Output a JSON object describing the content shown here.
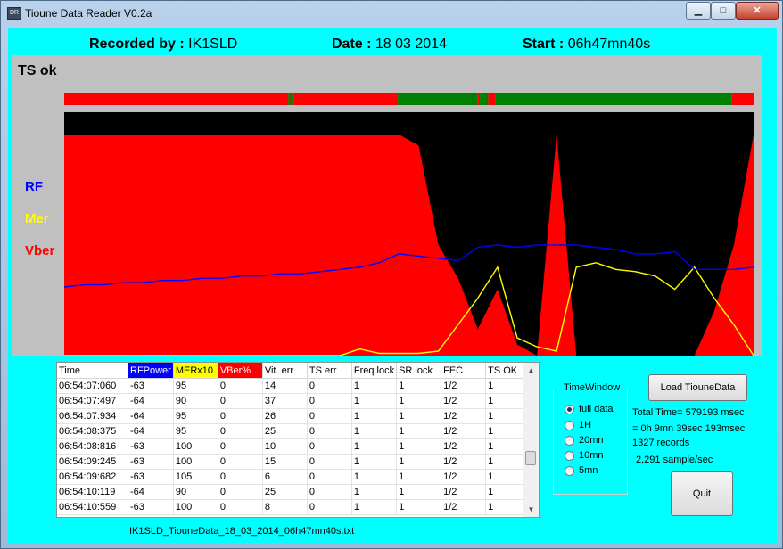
{
  "window": {
    "title": "Tioune Data Reader V0.2a",
    "icon_text": "DR",
    "min_glyph": "▁",
    "max_glyph": "□",
    "close_glyph": "✕"
  },
  "header": {
    "recorded_label": "Recorded by :",
    "recorded_value": "IK1SLD",
    "date_label": "Date :",
    "date_value": "18 03 2014",
    "start_label": "Start :",
    "start_value": "06h47mn40s"
  },
  "chart": {
    "ts_label": "TS ok",
    "rf_label": "RF",
    "mer_label": "Mer",
    "vber_label": "Vber",
    "colors": {
      "rf": "#0000ff",
      "mer": "#ffff00",
      "vber": "#ff0000",
      "ts_ok": "#008000",
      "ts_bad": "#ff0000",
      "background": "#000000",
      "panel": "#c0c0c0"
    }
  },
  "chart_data": {
    "type": "area",
    "title": "",
    "xlabel": "",
    "ylabel": "",
    "series": [
      {
        "name": "RF",
        "color": "#0000ff",
        "values": [
          31,
          32,
          32,
          33,
          33,
          34,
          34,
          35,
          35,
          36,
          36,
          37,
          37,
          38,
          39,
          40,
          42,
          46,
          45,
          44,
          43,
          49,
          50,
          49,
          50,
          50,
          50,
          49,
          48,
          46,
          46,
          47,
          39,
          39,
          39,
          40
        ]
      },
      {
        "name": "Mer",
        "color": "#ffff00",
        "values": [
          0,
          0,
          0,
          0,
          0,
          0,
          0,
          0,
          0,
          0,
          0,
          0,
          0,
          0,
          0,
          3,
          1,
          1,
          1,
          2,
          14,
          26,
          40,
          8,
          4,
          2,
          40,
          42,
          39,
          38,
          36,
          30,
          40,
          26,
          14,
          0
        ]
      },
      {
        "name": "Vber",
        "color": "#ff0000",
        "values": [
          100,
          100,
          100,
          100,
          100,
          100,
          100,
          100,
          100,
          100,
          100,
          100,
          100,
          100,
          100,
          100,
          100,
          100,
          95,
          50,
          35,
          12,
          30,
          5,
          0,
          100,
          0,
          0,
          0,
          0,
          0,
          0,
          0,
          20,
          50,
          100
        ]
      }
    ],
    "ts_ok": {
      "segments": [
        {
          "state": "bad",
          "from": 0,
          "to": 0.325
        },
        {
          "state": "ok",
          "from": 0.325,
          "to": 0.328
        },
        {
          "state": "bad",
          "from": 0.328,
          "to": 0.33
        },
        {
          "state": "ok",
          "from": 0.33,
          "to": 0.333
        },
        {
          "state": "bad",
          "from": 0.333,
          "to": 0.484
        },
        {
          "state": "ok",
          "from": 0.484,
          "to": 0.6
        },
        {
          "state": "bad",
          "from": 0.6,
          "to": 0.603
        },
        {
          "state": "ok",
          "from": 0.603,
          "to": 0.615
        },
        {
          "state": "bad",
          "from": 0.615,
          "to": 0.625
        },
        {
          "state": "ok",
          "from": 0.625,
          "to": 0.968
        },
        {
          "state": "bad",
          "from": 0.968,
          "to": 1
        }
      ]
    },
    "ylim": [
      0,
      100
    ],
    "grid": false,
    "legend": "left"
  },
  "table": {
    "columns": [
      {
        "label": "Time",
        "bg": ""
      },
      {
        "label": "RFPower",
        "bg": "#0000ff",
        "fg": "#ffffff"
      },
      {
        "label": "MERx10",
        "bg": "#ffff00",
        "fg": "#000000"
      },
      {
        "label": "VBer%",
        "bg": "#ff0000",
        "fg": "#ffffff"
      },
      {
        "label": "Vit. err",
        "bg": ""
      },
      {
        "label": "TS err",
        "bg": ""
      },
      {
        "label": "Freq lock",
        "bg": ""
      },
      {
        "label": "SR lock",
        "bg": ""
      },
      {
        "label": "FEC",
        "bg": ""
      },
      {
        "label": "TS OK",
        "bg": ""
      }
    ],
    "rows": [
      [
        "06:54:07:060",
        "-63",
        "95",
        "0",
        "14",
        "0",
        "1",
        "1",
        "1/2",
        "1"
      ],
      [
        "06:54:07:497",
        "-64",
        "90",
        "0",
        "37",
        "0",
        "1",
        "1",
        "1/2",
        "1"
      ],
      [
        "06:54:07:934",
        "-64",
        "95",
        "0",
        "26",
        "0",
        "1",
        "1",
        "1/2",
        "1"
      ],
      [
        "06:54:08:375",
        "-64",
        "95",
        "0",
        "25",
        "0",
        "1",
        "1",
        "1/2",
        "1"
      ],
      [
        "06:54:08:816",
        "-63",
        "100",
        "0",
        "10",
        "0",
        "1",
        "1",
        "1/2",
        "1"
      ],
      [
        "06:54:09:245",
        "-63",
        "100",
        "0",
        "15",
        "0",
        "1",
        "1",
        "1/2",
        "1"
      ],
      [
        "06:54:09:682",
        "-63",
        "105",
        "0",
        "6",
        "0",
        "1",
        "1",
        "1/2",
        "1"
      ],
      [
        "06:54:10:119",
        "-64",
        "90",
        "0",
        "25",
        "0",
        "1",
        "1",
        "1/2",
        "1"
      ],
      [
        "06:54:10:559",
        "-63",
        "100",
        "0",
        "8",
        "0",
        "1",
        "1",
        "1/2",
        "1"
      ]
    ],
    "scroll_up_glyph": "▲",
    "scroll_down_glyph": "▼"
  },
  "filename": "IK1SLD_TiouneData_18_03_2014_06h47mn40s.txt",
  "timewindow": {
    "title": "TimeWindow",
    "options": [
      "full data",
      "1H",
      "20mn",
      "10mn",
      "5mn"
    ],
    "selected": "full data"
  },
  "actions": {
    "load_label": "Load TiouneData",
    "quit_label": "Quit"
  },
  "stats": {
    "total_time": "Total Time= 579193 msec",
    "breakdown": "= 0h 9mn 39sec 193msec",
    "records": "1327 records",
    "rate": "2,291 sample/sec"
  }
}
